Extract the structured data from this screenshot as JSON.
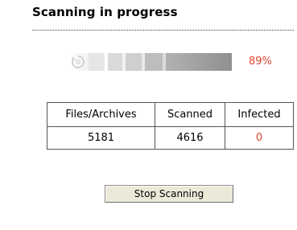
{
  "header": {
    "title": "Scanning in progress"
  },
  "progress": {
    "percent_label": "89%",
    "fraction": 0.89,
    "accent_color": "#e0452a",
    "icon": "spinner-icon"
  },
  "stats": {
    "headers": [
      "Files/Archives",
      "Scanned",
      "Infected"
    ],
    "values": [
      "5181",
      "4616",
      "0"
    ]
  },
  "actions": {
    "stop_label": "Stop Scanning"
  }
}
